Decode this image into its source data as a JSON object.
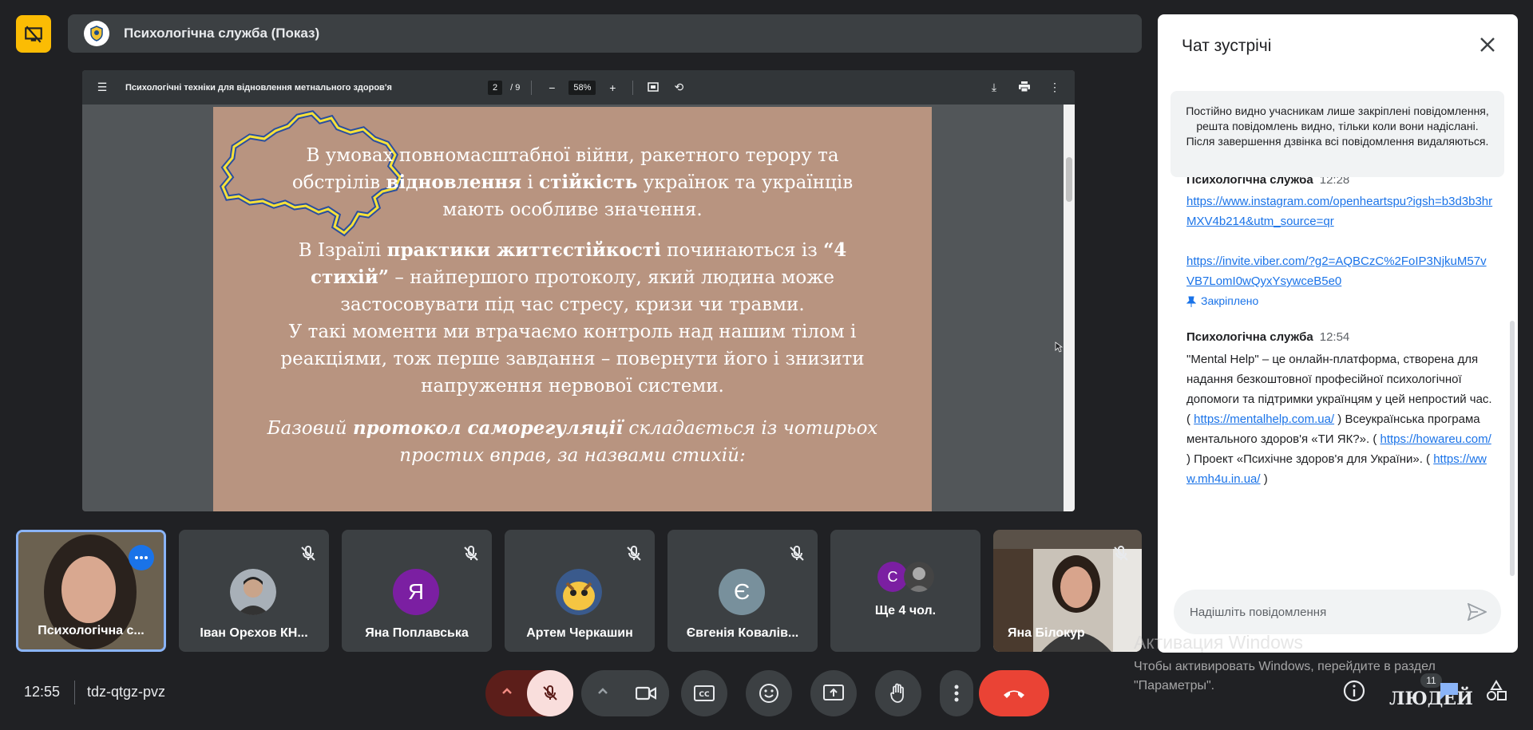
{
  "header": {
    "meeting_title": "Психологічна служба (Показ)"
  },
  "pdf": {
    "title": "Психологічні техніки для відновлення метнального здоров'я",
    "page_current": "2",
    "page_total": "/  9",
    "zoom": "58%",
    "slide": {
      "p1_line1": "В умовах повномасштабної війни, ракетного терору та",
      "p1_line2_a": "обстрілів ",
      "p1_line2_b": "відновлення",
      "p1_line2_c": " і ",
      "p1_line2_d": "стійкість",
      "p1_line2_e": " українок та українців",
      "p1_line3": "мають особливе значення.",
      "p2_line1_a": "В Ізраїлі ",
      "p2_line1_b": "практики життєстійкості",
      "p2_line1_c": " починаються із ",
      "p2_line1_d": "“4",
      "p2_line2_a": "стихій”",
      "p2_line2_b": " – найпершого протоколу, який людина може",
      "p2_line3": "застосовувати під час стресу, кризи чи травми.",
      "p3_line1": "У такі моменти ми втрачаємо контроль над нашим тілом і",
      "p3_line2": "реакціями, тож перше завдання – повернути його і знизити",
      "p3_line3": "напруження нервової системи.",
      "p4_line1_a": "Базовий ",
      "p4_line1_b": "протокол саморегуляції",
      "p4_line1_c": " складається із чотирьох",
      "p4_line2": "простих вправ, за назвами стихій:"
    }
  },
  "participants": [
    {
      "name": "Психологічна с...",
      "kind": "video"
    },
    {
      "name": "Іван Орєхов КН...",
      "kind": "photo"
    },
    {
      "name": "Яна Поплавська",
      "kind": "letter",
      "letter": "Я",
      "color": "#7b1fa2"
    },
    {
      "name": "Артем Черкашин",
      "kind": "photo"
    },
    {
      "name": "Євгенія Ковалів...",
      "kind": "letter",
      "letter": "Є",
      "color": "#78909c"
    },
    {
      "name": "Ще 4 чол.",
      "kind": "group",
      "letter": "С",
      "color": "#7b1fa2"
    },
    {
      "name": "Яна Білокур",
      "kind": "video"
    }
  ],
  "footer": {
    "time": "12:55",
    "meeting_code": "tdz-qtgz-pvz",
    "people_count": "11",
    "people_label": "ЛЮДЕЙ"
  },
  "chat": {
    "heading": "Чат зустрічі",
    "notice": "Постійно видно учасникам лише закріплені повідомлення, решта повідомлень видно, тільки коли вони надіслані. Після завершення дзвінка всі повідомлення видаляються.",
    "partial_sender": "Психологічна служба",
    "partial_time": "12:28",
    "link1": "https://www.instagram.com/openheartspu?igsh=b3d3b3hrMXV4b214&utm_source=qr",
    "link2": "https://invite.viber.com/?g2=AQBCzC%2FoIP3NjkuM57vVB7LomI0wQyxYsywceB5e0",
    "pinned_label": "Закріплено",
    "msg2_sender": "Психологічна служба",
    "msg2_time": "12:54",
    "msg2_text1": "\"Mental Help\" – це онлайн-платформа, створена для надання безкоштовної професійної психологічної допомоги та підтримки українцям у цей непростий час. (",
    "msg2_link1": "https://mentalhelp.com.ua/",
    "msg2_text2": " ) Всеукраїнська програма ментального здоров'я «ТИ ЯК?». (",
    "msg2_link2": "https://howareu.com/",
    "msg2_text3": " ) Проект «Психічне здоров'я для України». ( ",
    "msg2_link3": "https://www.mh4u.in.ua/",
    "msg2_text4": " )",
    "input_placeholder": "Надішліть повідомлення"
  },
  "watermark": {
    "line1": "Активация Windows",
    "line2": "Чтобы активировать Windows, перейдите в раздел \"Параметры\"."
  },
  "colors": {
    "accent": "#1a73e8",
    "end_call": "#ea4335",
    "presenting": "#fbbc04",
    "mic_muted_bg": "#f9dedc",
    "slide_bg": "#b89480"
  }
}
